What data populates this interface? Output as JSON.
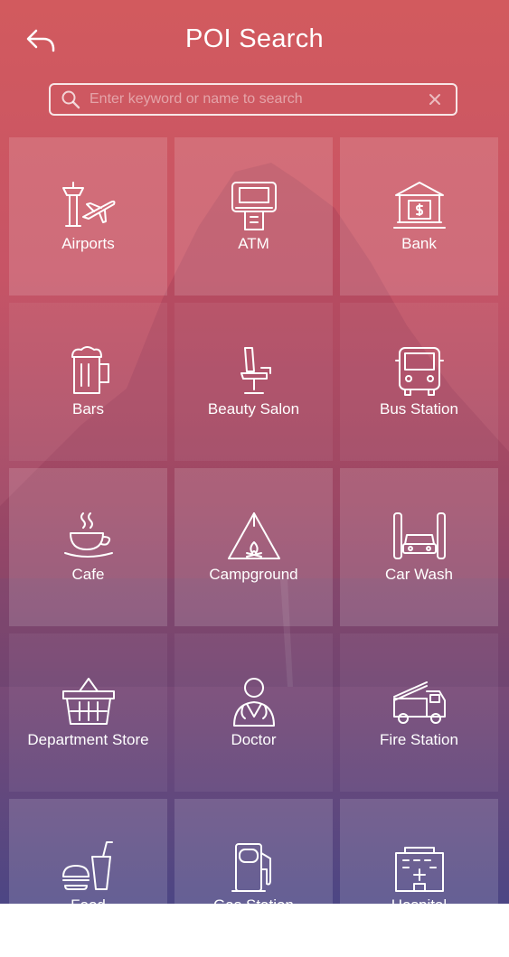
{
  "header": {
    "title": "POI Search",
    "back_icon": "back-arrow-icon"
  },
  "search": {
    "placeholder": "Enter keyword or name to search",
    "value": "",
    "search_icon": "search-icon",
    "clear_icon": "close-icon"
  },
  "categories": [
    {
      "label": "Airports",
      "icon": "airport-icon"
    },
    {
      "label": "ATM",
      "icon": "atm-icon"
    },
    {
      "label": "Bank",
      "icon": "bank-icon"
    },
    {
      "label": "Bars",
      "icon": "beer-mug-icon"
    },
    {
      "label": "Beauty Salon",
      "icon": "salon-chair-icon"
    },
    {
      "label": "Bus Station",
      "icon": "bus-icon"
    },
    {
      "label": "Cafe",
      "icon": "coffee-cup-icon"
    },
    {
      "label": "Campground",
      "icon": "tent-icon"
    },
    {
      "label": "Car Wash",
      "icon": "car-wash-icon"
    },
    {
      "label": "Department Store",
      "icon": "shopping-basket-icon"
    },
    {
      "label": "Doctor",
      "icon": "doctor-icon"
    },
    {
      "label": "Fire Station",
      "icon": "fire-truck-icon"
    },
    {
      "label": "Food",
      "icon": "fast-food-icon"
    },
    {
      "label": "Gas Station",
      "icon": "gas-pump-icon"
    },
    {
      "label": "Hospital",
      "icon": "hospital-icon"
    }
  ],
  "colors": {
    "gradient_top": "#d25a5e",
    "gradient_bottom": "#4c4684",
    "text": "#ffffff"
  }
}
